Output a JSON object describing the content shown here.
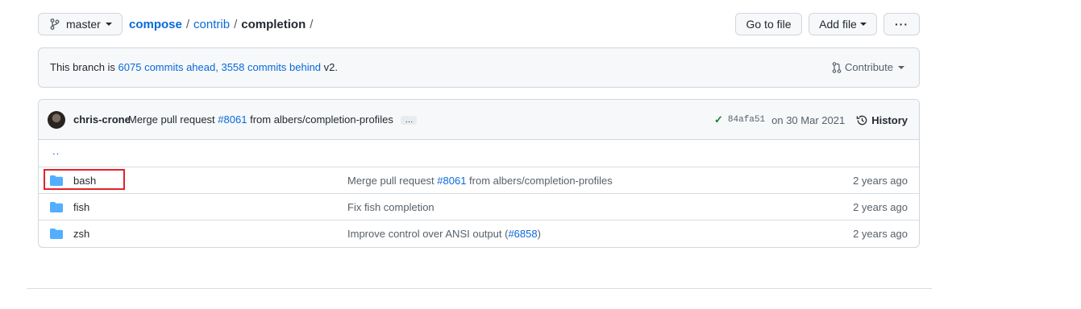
{
  "branch": {
    "name": "master",
    "icon": "git-branch-icon"
  },
  "breadcrumb": [
    {
      "label": "compose",
      "link": true
    },
    {
      "label": "contrib",
      "link": true
    },
    {
      "label": "completion",
      "link": false
    }
  ],
  "breadcrumb_sep": "/",
  "actions": {
    "goto_file": "Go to file",
    "add_file": "Add file",
    "more": "···"
  },
  "banner": {
    "prefix": "This branch is ",
    "ahead": "6075 commits ahead,",
    "behind": "3558 commits behind",
    "suffix": "v2.",
    "contribute": "Contribute"
  },
  "commit": {
    "author": "chris-crone",
    "message_prefix": "Merge pull request",
    "pr": "#8061",
    "message_suffix": "from albers/completion-profiles",
    "ellipsis": "…",
    "check": "✓",
    "sha": "84afa51",
    "date": "on 30 Mar 2021",
    "history": "History"
  },
  "parent_dir": "..",
  "files": [
    {
      "name": "bash",
      "msg_prefix": "Merge pull request ",
      "msg_link": "#8061",
      "msg_suffix": " from albers/completion-profiles",
      "age": "2 years ago"
    },
    {
      "name": "fish",
      "msg_prefix": "Fix fish completion",
      "msg_link": "",
      "msg_suffix": "",
      "age": "2 years ago"
    },
    {
      "name": "zsh",
      "msg_prefix": "Improve control over ANSI output (",
      "msg_link": "#6858",
      "msg_suffix": ")",
      "age": "2 years ago"
    }
  ],
  "colors": {
    "link": "#0969da",
    "folder": "#54aeff",
    "highlight": "#e0242a",
    "check": "#1a7f37"
  }
}
